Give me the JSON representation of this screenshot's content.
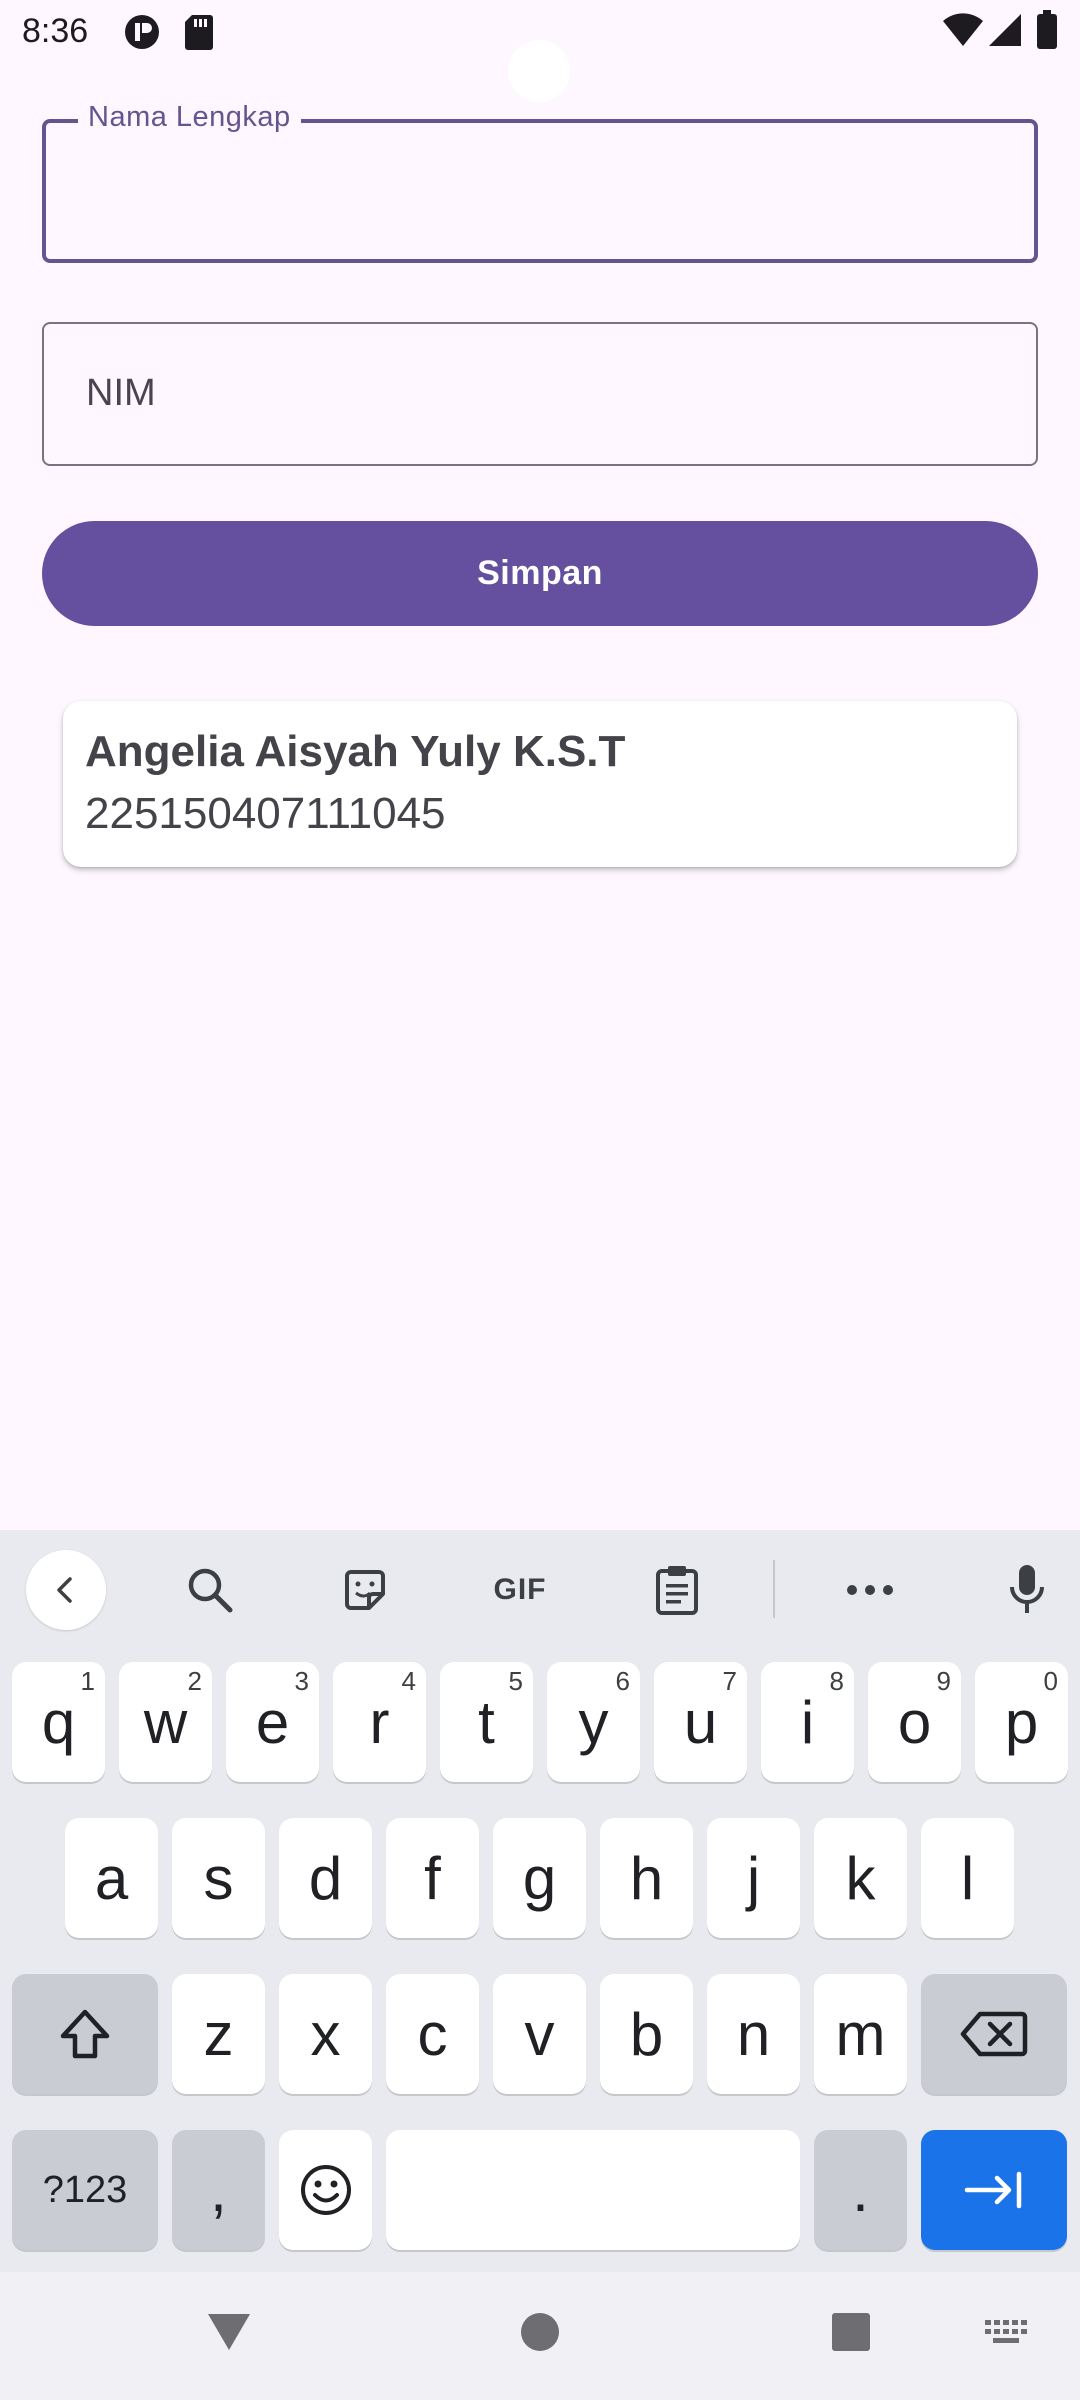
{
  "status_bar": {
    "time": "8:36",
    "icons": [
      "app-notification-icon",
      "sd-card-icon",
      "wifi-icon",
      "signal-icon",
      "battery-icon"
    ]
  },
  "form": {
    "name_field": {
      "label": "Nama Lengkap",
      "value": ""
    },
    "nim_field": {
      "placeholder": "NIM",
      "value": ""
    },
    "save_label": "Simpan"
  },
  "records": [
    {
      "name": "Angelia Aisyah Yuly K.S.T",
      "nim": "225150407111045"
    }
  ],
  "keyboard": {
    "toolbar": {
      "items": [
        "back-icon",
        "search-icon",
        "sticker-icon",
        "gif-icon",
        "clipboard-icon",
        "more-icon",
        "mic-icon"
      ],
      "gif_label": "GIF"
    },
    "row1": [
      {
        "key": "q",
        "hint": "1"
      },
      {
        "key": "w",
        "hint": "2"
      },
      {
        "key": "e",
        "hint": "3"
      },
      {
        "key": "r",
        "hint": "4"
      },
      {
        "key": "t",
        "hint": "5"
      },
      {
        "key": "y",
        "hint": "6"
      },
      {
        "key": "u",
        "hint": "7"
      },
      {
        "key": "i",
        "hint": "8"
      },
      {
        "key": "o",
        "hint": "9"
      },
      {
        "key": "p",
        "hint": "0"
      }
    ],
    "row2": [
      "a",
      "s",
      "d",
      "f",
      "g",
      "h",
      "j",
      "k",
      "l"
    ],
    "row3": [
      "z",
      "x",
      "c",
      "v",
      "b",
      "n",
      "m"
    ],
    "bottom": {
      "symbols": "?123",
      "comma": ",",
      "period": "."
    }
  },
  "colors": {
    "primary": "#65558f",
    "button": "#65509f",
    "background": "#fef7ff",
    "action_key": "#1a73e8"
  }
}
